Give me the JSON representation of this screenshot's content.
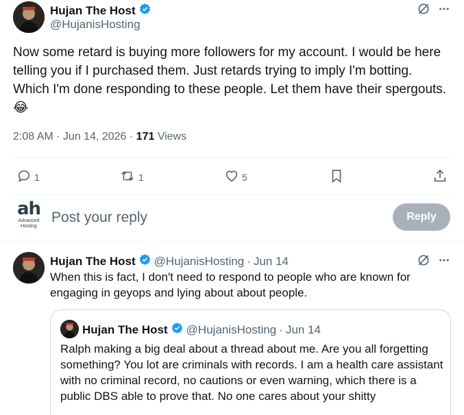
{
  "main_tweet": {
    "author_name": "Hujan The Host",
    "author_handle": "@HujanisHosting",
    "text": "Now some retard is buying more followers for my account. I would be here telling you if I purchased them. Just retards trying to imply I'm botting. Which I'm done responding to these people. Let them have their spergouts. 😂",
    "time": "2:08 AM · Jun 14, 2026 · ",
    "views_count": "171",
    "views_label": "Views",
    "reply_count": "1",
    "retweet_count": "1",
    "like_count": "5"
  },
  "composer": {
    "logo_text": "ah",
    "logo_sub": "Advanced Hosting",
    "placeholder": "Post your reply",
    "reply_button": "Reply"
  },
  "reply_tweet": {
    "author_name": "Hujan The Host",
    "author_handle": "@HujanisHosting",
    "dot": "·",
    "date": "Jun 14",
    "text": "When this is fact, I don't need to respond to people who are known for engaging in geyops and lying about about people."
  },
  "quoted_tweet": {
    "author_name": "Hujan The Host",
    "author_handle": "@HujanisHosting",
    "dot": "·",
    "date": "Jun 14",
    "text": "Ralph making a big deal about a thread about me. Are you all forgetting something? You lot are criminals with records. I am a health care assistant with no criminal record, no cautions or even warning, which there is a public DBS able to prove that. No one cares about your shitty"
  },
  "colors": {
    "verified": "#1d9bf0",
    "secondary_text": "#536471",
    "reply_button_bg": "#8b98a5"
  },
  "icons": [
    "verified-badge-icon",
    "grok-icon",
    "more-icon",
    "reply-icon",
    "retweet-icon",
    "like-icon",
    "bookmark-icon",
    "share-icon"
  ]
}
